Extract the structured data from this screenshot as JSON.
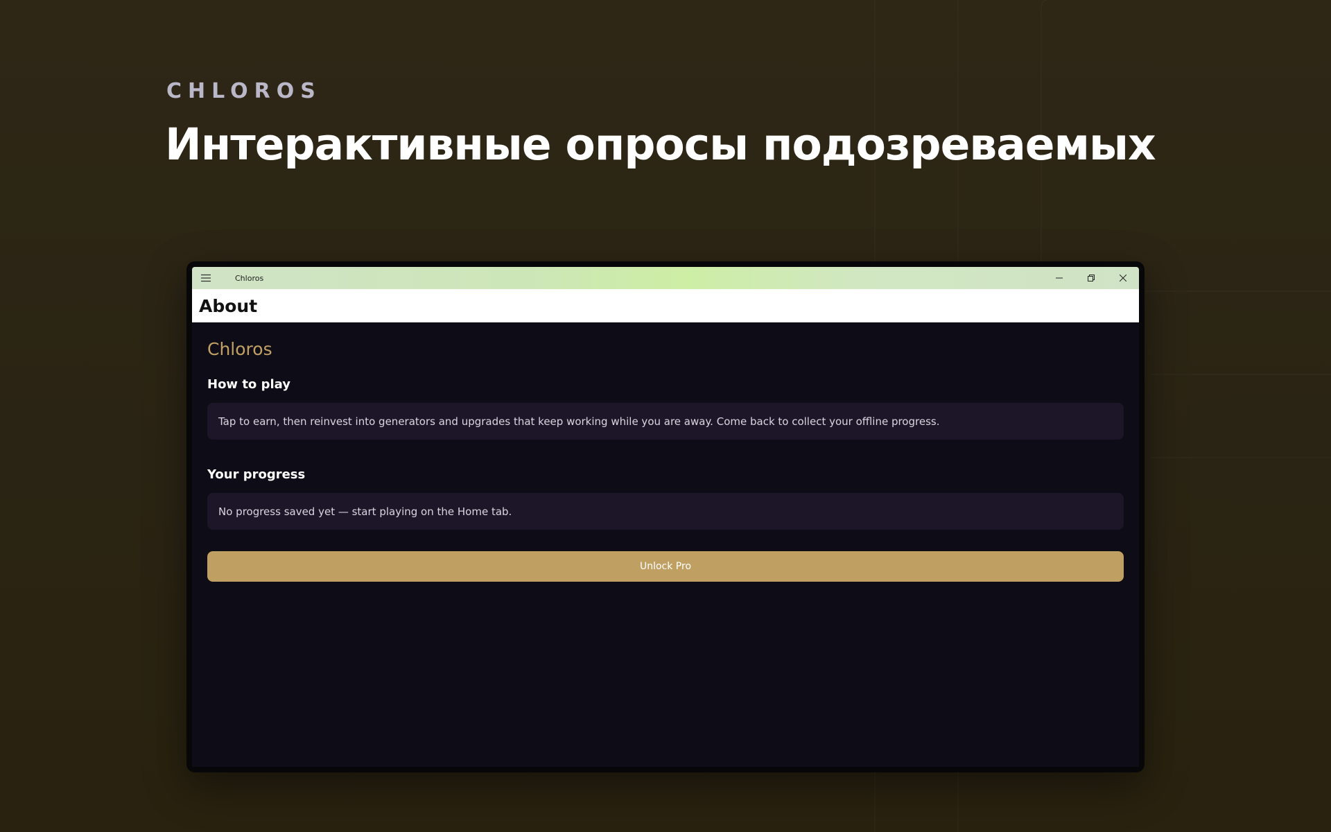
{
  "hero": {
    "brand": "CHLOROS",
    "title": "Интерактивные опросы подозреваемых"
  },
  "window": {
    "app_title": "Chloros",
    "icons": {
      "menu": "hamburger-menu-icon",
      "minimize": "minimize-icon",
      "maximize": "restore-icon",
      "close": "close-icon"
    }
  },
  "page": {
    "title": "About",
    "app_name": "Chloros",
    "sections": [
      {
        "title": "How to play",
        "text": "Tap to earn, then reinvest into generators and upgrades that keep working while you are away. Come back to collect your offline progress."
      },
      {
        "title": "Your progress",
        "text": "No progress saved yet — start playing on the Home tab."
      }
    ],
    "cta_label": "Unlock Pro"
  },
  "colors": {
    "background": "#2e2716",
    "accent_gold": "#c09f62",
    "app_name_color": "#c3a165",
    "content_bg": "#0e0c16",
    "card_bg": "#1c1628",
    "titlebar_green": "#cdeea4"
  }
}
